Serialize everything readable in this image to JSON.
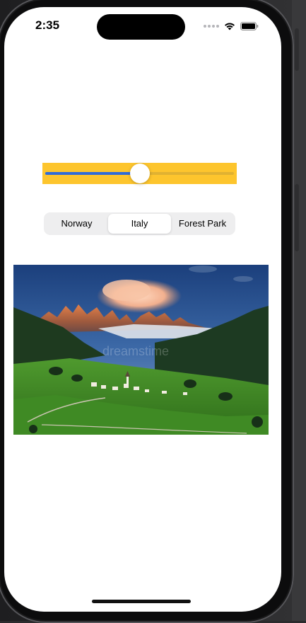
{
  "status_bar": {
    "time": "2:35",
    "icons": [
      "signal-dots-icon",
      "wifi-icon",
      "battery-icon"
    ]
  },
  "slider": {
    "value": 0.5,
    "background_color": "#fdc52d",
    "tint_color": "#2f6bd8"
  },
  "segmented_control": {
    "segments": [
      "Norway",
      "Italy",
      "Forest Park"
    ],
    "selected_index": 1
  },
  "image": {
    "watermark": "dreamstime",
    "subject": "Dolomites mountain village landscape"
  }
}
